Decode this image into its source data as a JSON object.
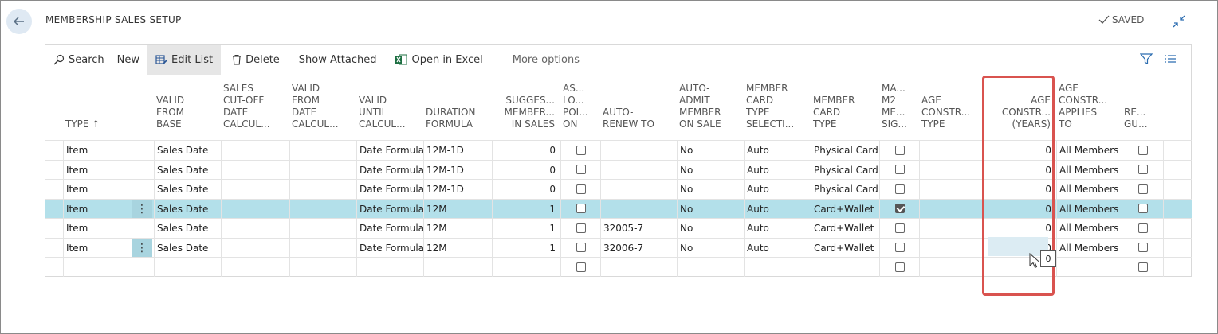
{
  "header": {
    "title": "MEMBERSHIP SALES SETUP",
    "saved_label": "SAVED"
  },
  "actionbar": {
    "search": "Search",
    "new": "New",
    "edit_list": "Edit List",
    "delete": "Delete",
    "show_attached": "Show Attached",
    "open_in_excel": "Open in Excel",
    "more_options": "More options"
  },
  "columns": [
    {
      "lines": [
        "TYPE ↑"
      ]
    },
    {
      "lines": [
        "VALID",
        "FROM",
        "BASE"
      ]
    },
    {
      "lines": [
        "SALES",
        "CUT-OFF",
        "DATE",
        "CALCUL..."
      ]
    },
    {
      "lines": [
        "VALID",
        "FROM",
        "DATE",
        "CALCUL..."
      ]
    },
    {
      "lines": [
        "VALID",
        "UNTIL",
        "CALCUL..."
      ]
    },
    {
      "lines": [
        "DURATION",
        "FORMULA"
      ]
    },
    {
      "lines": [
        "SUGGES...",
        "MEMBER...",
        "IN SALES"
      ]
    },
    {
      "lines": [
        "AS...",
        "LO...",
        "POI...",
        "ON"
      ]
    },
    {
      "lines": [
        "AUTO-",
        "RENEW TO"
      ]
    },
    {
      "lines": [
        "AUTO-",
        "ADMIT",
        "MEMBER",
        "ON SALE"
      ]
    },
    {
      "lines": [
        "MEMBER",
        "CARD",
        "TYPE",
        "SELECTI..."
      ]
    },
    {
      "lines": [
        "MEMBER",
        "CARD",
        "TYPE"
      ]
    },
    {
      "lines": [
        "MA...",
        "M2",
        "ME...",
        "SIG..."
      ]
    },
    {
      "lines": [
        "AGE",
        "CONSTR...",
        "TYPE"
      ]
    },
    {
      "lines": [
        "AGE",
        "CONSTR...",
        "(YEARS)"
      ]
    },
    {
      "lines": [
        "AGE",
        "CONSTR...",
        "APPLIES",
        "TO"
      ]
    },
    {
      "lines": [
        "RE...",
        "GU..."
      ]
    }
  ],
  "rows": [
    {
      "type": "Item",
      "valid_from_base": "Sales Date",
      "valid_until": "Date Formula",
      "duration": "12M-1D",
      "suggested": "0",
      "auto_renew_to": "",
      "auto_admit": "No",
      "card_type_sel": "Auto",
      "card_type": "Physical Card",
      "m2_checked": false,
      "age_years": "0",
      "applies_to": "All Members",
      "selected": false,
      "has_dots": false
    },
    {
      "type": "Item",
      "valid_from_base": "Sales Date",
      "valid_until": "Date Formula",
      "duration": "12M-1D",
      "suggested": "0",
      "auto_renew_to": "",
      "auto_admit": "No",
      "card_type_sel": "Auto",
      "card_type": "Physical Card",
      "m2_checked": false,
      "age_years": "0",
      "applies_to": "All Members",
      "selected": false,
      "has_dots": false
    },
    {
      "type": "Item",
      "valid_from_base": "Sales Date",
      "valid_until": "Date Formula",
      "duration": "12M-1D",
      "suggested": "0",
      "auto_renew_to": "",
      "auto_admit": "No",
      "card_type_sel": "Auto",
      "card_type": "Physical Card",
      "m2_checked": false,
      "age_years": "0",
      "applies_to": "All Members",
      "selected": false,
      "has_dots": false
    },
    {
      "type": "Item",
      "valid_from_base": "Sales Date",
      "valid_until": "Date Formula",
      "duration": "12M",
      "suggested": "1",
      "auto_renew_to": "",
      "auto_admit": "No",
      "card_type_sel": "Auto",
      "card_type": "Card+Wallet",
      "m2_checked": true,
      "age_years": "0",
      "applies_to": "All Members",
      "selected": true,
      "has_dots": true
    },
    {
      "type": "Item",
      "valid_from_base": "Sales Date",
      "valid_until": "Date Formula",
      "duration": "12M",
      "suggested": "1",
      "auto_renew_to": "32005-7",
      "auto_admit": "No",
      "card_type_sel": "Auto",
      "card_type": "Card+Wallet",
      "m2_checked": false,
      "age_years": "0",
      "applies_to": "All Members",
      "selected": false,
      "has_dots": false
    },
    {
      "type": "Item",
      "valid_from_base": "Sales Date",
      "valid_until": "Date Formula",
      "duration": "12M",
      "suggested": "1",
      "auto_renew_to": "32006-7",
      "auto_admit": "No",
      "card_type_sel": "Auto",
      "card_type": "Card+Wallet",
      "m2_checked": false,
      "age_years": "0",
      "applies_to": "All Members",
      "selected": false,
      "has_dots": true
    },
    {
      "type": "",
      "valid_from_base": "",
      "valid_until": "",
      "duration": "",
      "suggested": "",
      "auto_renew_to": "",
      "auto_admit": "",
      "card_type_sel": "",
      "card_type": "",
      "m2_checked": false,
      "age_years": "",
      "applies_to": "",
      "selected": false,
      "has_dots": false,
      "empty": true
    }
  ],
  "tooltip_value": "0",
  "colors": {
    "accent": "#b3e0ea",
    "highlight": "#d9534f"
  }
}
